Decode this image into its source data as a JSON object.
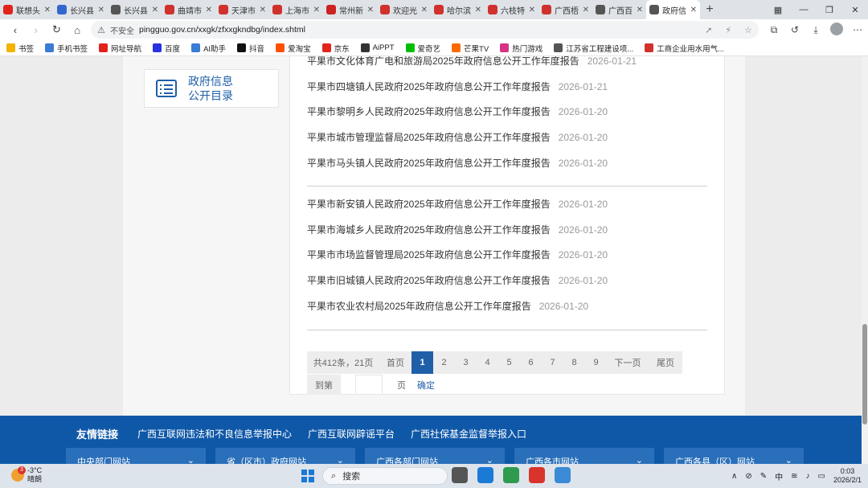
{
  "browser": {
    "tabs": [
      {
        "label": "联想头",
        "color": "#e2231a"
      },
      {
        "label": "长兴县",
        "color": "#3366cc"
      },
      {
        "label": "长兴县",
        "color": "#555555"
      },
      {
        "label": "曲靖市",
        "color": "#d0312d"
      },
      {
        "label": "天津市",
        "color": "#d0312d"
      },
      {
        "label": "上海市",
        "color": "#d0312d"
      },
      {
        "label": "常州新",
        "color": "#cc2222"
      },
      {
        "label": "欢迎光",
        "color": "#d0312d"
      },
      {
        "label": "哈尔滨",
        "color": "#d0312d"
      },
      {
        "label": "六枝特",
        "color": "#d0312d"
      },
      {
        "label": "广西梧",
        "color": "#d0312d"
      },
      {
        "label": "广西百",
        "color": "#555555"
      },
      {
        "label": "政府信",
        "color": "#555555",
        "active": true
      }
    ],
    "new_tab": "+",
    "address": {
      "insecure_label": "不安全",
      "url": "pingguo.gov.cn/xxgk/zfxxgkndbg/index.shtml"
    },
    "bookmarks": [
      {
        "label": "书签",
        "color": "#f2b400"
      },
      {
        "label": "手机书签",
        "color": "#3a7bd5"
      },
      {
        "label": "网址导航",
        "color": "#e2231a"
      },
      {
        "label": "百度",
        "color": "#2932e1"
      },
      {
        "label": "AI助手",
        "color": "#3a7bd5"
      },
      {
        "label": "抖音",
        "color": "#111111"
      },
      {
        "label": "爱淘宝",
        "color": "#ff5000"
      },
      {
        "label": "京东",
        "color": "#e1251b"
      },
      {
        "label": "AiPPT",
        "color": "#333333"
      },
      {
        "label": "爱奇艺",
        "color": "#00be06"
      },
      {
        "label": "芒果TV",
        "color": "#ff6a00"
      },
      {
        "label": "热门游戏",
        "color": "#d63384"
      },
      {
        "label": "江苏省工程建设项...",
        "color": "#555555"
      },
      {
        "label": "工商企业用水用气...",
        "color": "#d0312d"
      }
    ]
  },
  "sidebar": {
    "card_title_line1": "政府信息",
    "card_title_line2": "公开目录"
  },
  "list": {
    "group1": [
      {
        "title": "平果市文化体育广电和旅游局2025年政府信息公开工作年度报告",
        "date": "2026-01-21"
      },
      {
        "title": "平果市四塘镇人民政府2025年政府信息公开工作年度报告",
        "date": "2026-01-21"
      },
      {
        "title": "平果市黎明乡人民政府2025年政府信息公开工作年度报告",
        "date": "2026-01-20"
      },
      {
        "title": "平果市城市管理监督局2025年政府信息公开工作年度报告",
        "date": "2026-01-20"
      },
      {
        "title": "平果市马头镇人民政府2025年政府信息公开工作年度报告",
        "date": "2026-01-20"
      }
    ],
    "group2": [
      {
        "title": "平果市新安镇人民政府2025年政府信息公开工作年度报告",
        "date": "2026-01-20"
      },
      {
        "title": "平果市海城乡人民政府2025年政府信息公开工作年度报告",
        "date": "2026-01-20"
      },
      {
        "title": "平果市市场监督管理局2025年政府信息公开工作年度报告",
        "date": "2026-01-20"
      },
      {
        "title": "平果市旧城镇人民政府2025年政府信息公开工作年度报告",
        "date": "2026-01-20"
      },
      {
        "title": "平果市农业农村局2025年政府信息公开工作年度报告",
        "date": "2026-01-20"
      }
    ]
  },
  "pager": {
    "summary": "共412条，21页",
    "first": "首页",
    "pages": [
      "1",
      "2",
      "3",
      "4",
      "5",
      "6",
      "7",
      "8",
      "9"
    ],
    "current": "1",
    "next": "下一页",
    "last": "尾页",
    "goto_prefix": "到第",
    "goto_suffix": "页",
    "confirm": "确定"
  },
  "footer": {
    "links_heading": "友情链接",
    "links": [
      "广西互联网违法和不良信息举报中心",
      "广西互联网辟谣平台",
      "广西社保基金监督举报入口"
    ],
    "dropdowns": [
      "中央部门网站",
      "省（区市）政府网站",
      "广西各部门网站",
      "广西各市网站",
      "广西各县（区）网站"
    ]
  },
  "taskbar": {
    "weather_badge": "3",
    "temperature": "-3°C",
    "weather_text": "晴朗",
    "search_placeholder": "搜索",
    "ime": "中",
    "time": "0:03",
    "date": "2026/2/1"
  }
}
